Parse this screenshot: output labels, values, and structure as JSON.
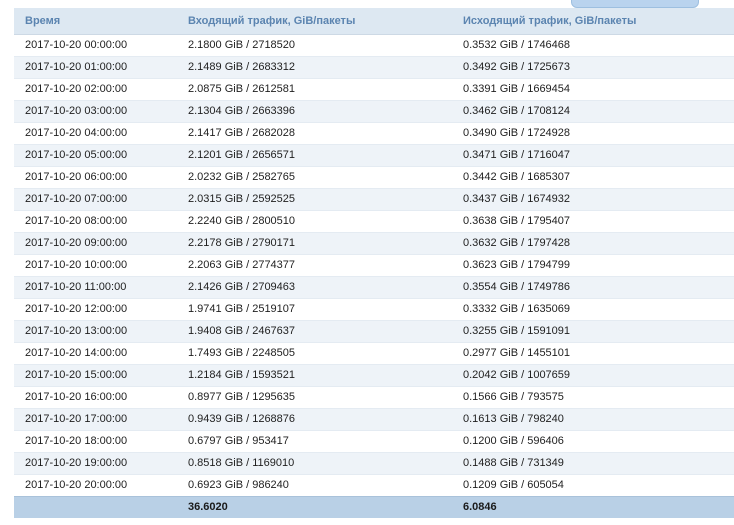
{
  "table": {
    "headers": {
      "time": "Время",
      "incoming": "Входящий трафик, GiB/пакеты",
      "outgoing": "Исходящий трафик, GiB/пакеты"
    },
    "rows": [
      {
        "time": "2017-10-20 00:00:00",
        "incoming": "2.1800 GiB / 2718520",
        "outgoing": "0.3532 GiB / 1746468"
      },
      {
        "time": "2017-10-20 01:00:00",
        "incoming": "2.1489 GiB / 2683312",
        "outgoing": "0.3492 GiB / 1725673"
      },
      {
        "time": "2017-10-20 02:00:00",
        "incoming": "2.0875 GiB / 2612581",
        "outgoing": "0.3391 GiB / 1669454"
      },
      {
        "time": "2017-10-20 03:00:00",
        "incoming": "2.1304 GiB / 2663396",
        "outgoing": "0.3462 GiB / 1708124"
      },
      {
        "time": "2017-10-20 04:00:00",
        "incoming": "2.1417 GiB / 2682028",
        "outgoing": "0.3490 GiB / 1724928"
      },
      {
        "time": "2017-10-20 05:00:00",
        "incoming": "2.1201 GiB / 2656571",
        "outgoing": "0.3471 GiB / 1716047"
      },
      {
        "time": "2017-10-20 06:00:00",
        "incoming": "2.0232 GiB / 2582765",
        "outgoing": "0.3442 GiB / 1685307"
      },
      {
        "time": "2017-10-20 07:00:00",
        "incoming": "2.0315 GiB / 2592525",
        "outgoing": "0.3437 GiB / 1674932"
      },
      {
        "time": "2017-10-20 08:00:00",
        "incoming": "2.2240 GiB / 2800510",
        "outgoing": "0.3638 GiB / 1795407"
      },
      {
        "time": "2017-10-20 09:00:00",
        "incoming": "2.2178 GiB / 2790171",
        "outgoing": "0.3632 GiB / 1797428"
      },
      {
        "time": "2017-10-20 10:00:00",
        "incoming": "2.2063 GiB / 2774377",
        "outgoing": "0.3623 GiB / 1794799"
      },
      {
        "time": "2017-10-20 11:00:00",
        "incoming": "2.1426 GiB / 2709463",
        "outgoing": "0.3554 GiB / 1749786"
      },
      {
        "time": "2017-10-20 12:00:00",
        "incoming": "1.9741 GiB / 2519107",
        "outgoing": "0.3332 GiB / 1635069"
      },
      {
        "time": "2017-10-20 13:00:00",
        "incoming": "1.9408 GiB / 2467637",
        "outgoing": "0.3255 GiB / 1591091"
      },
      {
        "time": "2017-10-20 14:00:00",
        "incoming": "1.7493 GiB / 2248505",
        "outgoing": "0.2977 GiB / 1455101"
      },
      {
        "time": "2017-10-20 15:00:00",
        "incoming": "1.2184 GiB / 1593521",
        "outgoing": "0.2042 GiB / 1007659"
      },
      {
        "time": "2017-10-20 16:00:00",
        "incoming": "0.8977 GiB / 1295635",
        "outgoing": "0.1566 GiB / 793575"
      },
      {
        "time": "2017-10-20 17:00:00",
        "incoming": "0.9439 GiB / 1268876",
        "outgoing": "0.1613 GiB / 798240"
      },
      {
        "time": "2017-10-20 18:00:00",
        "incoming": "0.6797 GiB / 953417",
        "outgoing": "0.1200 GiB / 596406"
      },
      {
        "time": "2017-10-20 19:00:00",
        "incoming": "0.8518 GiB / 1169010",
        "outgoing": "0.1488 GiB / 731349"
      },
      {
        "time": "2017-10-20 20:00:00",
        "incoming": "0.6923 GiB / 986240",
        "outgoing": "0.1209 GiB / 605054"
      }
    ],
    "totals": {
      "time": "",
      "incoming": "36.6020",
      "outgoing": "6.0846"
    }
  }
}
